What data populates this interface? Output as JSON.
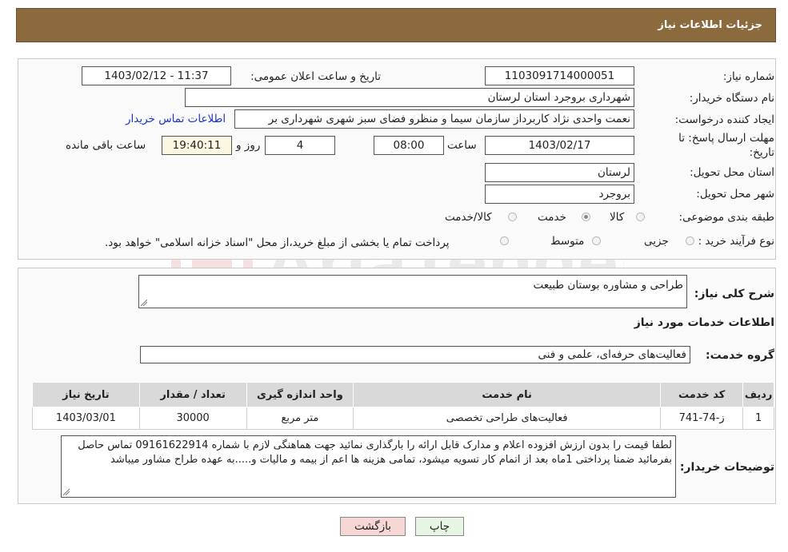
{
  "header": {
    "title": "جزئیات اطلاعات نیاز"
  },
  "form": {
    "need_number_label": "شماره نیاز:",
    "need_number": "1103091714000051",
    "announce_label": "تاریخ و ساعت اعلان عمومی:",
    "announce_value": "1403/02/12 - 11:37",
    "buyer_label": "نام دستگاه خریدار:",
    "buyer_value": "شهرداری بروجرد استان لرستان",
    "creator_label": "ایجاد کننده درخواست:",
    "creator_value": "نعمت واحدی نژاد کاربرداز سازمان سیما و منظرو فضای سبز شهری شهرداری بر",
    "contact_link": "اطلاعات تماس خریدار",
    "deadline_label_1": "مهلت ارسال پاسخ: تا",
    "deadline_label_2": "تاریخ:",
    "deadline_date": "1403/02/17",
    "time_label": "ساعت",
    "deadline_time": "08:00",
    "days_value": "4",
    "days_label": "روز و",
    "remaining_time": "19:40:11",
    "remaining_label": "ساعت باقی مانده",
    "province_label": "استان محل تحویل:",
    "province_value": "لرستان",
    "city_label": "شهر محل تحویل:",
    "city_value": "بروجرد",
    "category_label": "طبقه بندی موضوعی:",
    "category_options": [
      "کالا",
      "خدمت",
      "کالا/خدمت"
    ],
    "category_selected": "خدمت",
    "process_label": "نوع فرآیند خرید :",
    "process_options": [
      "جزیی",
      "متوسط"
    ],
    "payment_note": "پرداخت تمام یا بخشی از مبلغ خرید،از محل \"اسناد خزانه اسلامی\" خواهد بود."
  },
  "details": {
    "summary_label": "شرح کلی نیاز:",
    "summary_value": "طراحی و مشاوره بوستان طبیعت",
    "services_title": "اطلاعات خدمات مورد نیاز",
    "group_label": "گروه خدمت:",
    "group_value": "فعالیت‌های حرفه‌ای، علمی و فنی",
    "table": {
      "headers": [
        "ردیف",
        "کد خدمت",
        "نام خدمت",
        "واحد اندازه گیری",
        "تعداد / مقدار",
        "تاریخ نیاز"
      ],
      "rows": [
        [
          "1",
          "ز-74-741",
          "فعالیت‌های طراحی تخصصی",
          "متر مربع",
          "30000",
          "1403/03/01"
        ]
      ]
    },
    "buyer_notes_label": "توضیحات خریدار:",
    "buyer_notes": "لطفا قیمت را بدون ارزش افزوده اعلام و مدارک قابل ارائه را بارگذاری نمائید جهت هماهنگی لازم با شماره 09161622914 تماس حاصل بفرمائید ضمنا پرداختی  1ماه بعد از اتمام کار تسویه میشود، تمامی هزینه ها اعم از بیمه و مالیات و.....به عهده طراح مشاور میباشد"
  },
  "buttons": {
    "print": "چاپ",
    "back": "بازگشت"
  },
  "watermark_text": "AriaTender.neT",
  "colors": {
    "header_bg": "#8b6a3e",
    "link": "#1a33cc",
    "back_bg": "#f7d6d6",
    "print_bg": "#e6f6e2"
  }
}
